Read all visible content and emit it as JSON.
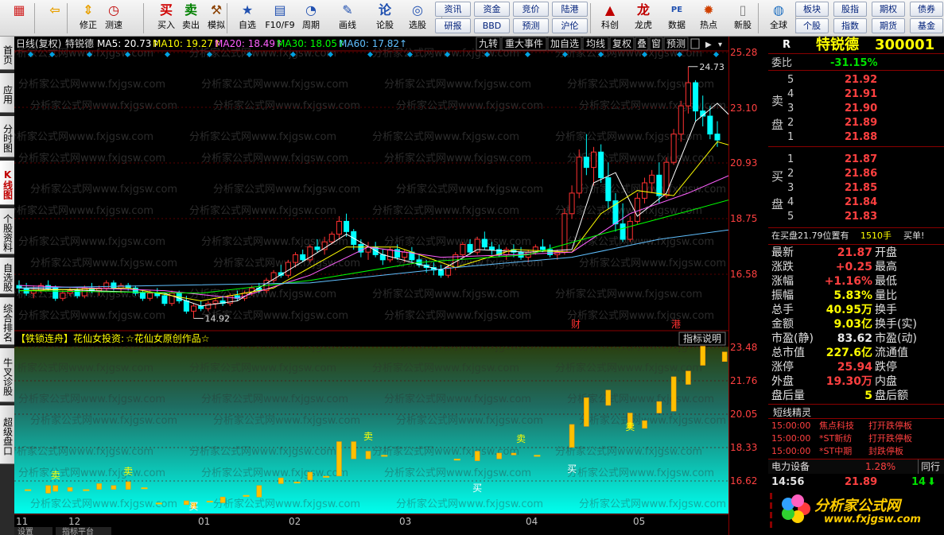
{
  "toolbar": {
    "items": [
      {
        "label": "",
        "icon": "windows-icon",
        "glyph": "▦",
        "color": "#d02020"
      },
      {
        "label": "",
        "icon": "back-icon",
        "glyph": "⇦",
        "color": "#e8a000"
      },
      {
        "label": "修正",
        "icon": "arrow-updown-icon",
        "glyph": "⇕",
        "color": "#e8a000"
      },
      {
        "label": "测速",
        "icon": "clock-icon",
        "glyph": "◷",
        "color": "#c00000"
      },
      {
        "label": "买入",
        "icon": "buy-icon",
        "glyph": "买",
        "color": "#d00000"
      },
      {
        "label": "卖出",
        "icon": "sell-icon",
        "glyph": "卖",
        "color": "#008000"
      },
      {
        "label": "模拟",
        "icon": "hammer-icon",
        "glyph": "⚒",
        "color": "#8a4000"
      },
      {
        "label": "自选",
        "icon": "star-icon",
        "glyph": "★",
        "color": "#2050b0"
      },
      {
        "label": "F10/F9",
        "icon": "f10-icon",
        "glyph": "▤",
        "color": "#2050b0"
      },
      {
        "label": "周期",
        "icon": "period-icon",
        "glyph": "◔",
        "color": "#2050b0"
      },
      {
        "label": "画线",
        "icon": "pen-icon",
        "glyph": "✎",
        "color": "#2050b0"
      },
      {
        "label": "论股",
        "icon": "chat-icon",
        "glyph": "论",
        "color": "#2050b0"
      },
      {
        "label": "选股",
        "icon": "select-icon",
        "glyph": "◎",
        "color": "#2050b0"
      },
      {
        "label": "科创",
        "icon": "chart-icon",
        "glyph": "▲",
        "color": "#c00000"
      },
      {
        "label": "龙虎",
        "icon": "dragon-icon",
        "glyph": "龙",
        "color": "#c00000"
      },
      {
        "label": "数据",
        "icon": "pe-icon",
        "glyph": "PE",
        "color": "#2050b0"
      },
      {
        "label": "热点",
        "icon": "fire-icon",
        "glyph": "✹",
        "color": "#d04000"
      },
      {
        "label": "新股",
        "icon": "doc-icon",
        "glyph": "▯",
        "color": "#808080"
      },
      {
        "label": "全球",
        "icon": "globe-icon",
        "glyph": "◍",
        "color": "#2070c0"
      }
    ],
    "buttons": [
      [
        "资讯",
        "资金",
        "竞价",
        "陆港"
      ],
      [
        "研报",
        "BBD",
        "预测",
        "沪伦"
      ]
    ],
    "right_buttons": [
      [
        "板块",
        "股指",
        "期权",
        "债券"
      ],
      [
        "个股",
        "指数",
        "期货",
        "基金"
      ]
    ]
  },
  "left_tabs": [
    {
      "label": "首页",
      "active": false
    },
    {
      "label": "应用",
      "active": false
    },
    {
      "label": "分时图",
      "active": false
    },
    {
      "label": "K线图",
      "active": true
    },
    {
      "label": "个股资料",
      "active": false
    },
    {
      "label": "自选股",
      "active": false
    },
    {
      "label": "综合排名",
      "active": false
    },
    {
      "label": "牛叉诊股",
      "active": false
    },
    {
      "label": "超级盘口",
      "active": false
    }
  ],
  "chart_header": {
    "period": "日线(复权)",
    "name": "特锐德",
    "ma": [
      {
        "label": "MA5: 20.73↑",
        "color": "#ffffff"
      },
      {
        "label": "MA10: 19.27↑",
        "color": "#ffff00"
      },
      {
        "label": "MA20: 18.49↑",
        "color": "#ff60ff"
      },
      {
        "label": "MA30: 18.05↑",
        "color": "#00ff00"
      },
      {
        "label": "MA60: 17.82↑",
        "color": "#60c0ff"
      }
    ],
    "menu": [
      "九转",
      "重大事件",
      "加自选",
      "均线",
      "复权",
      "叠",
      "窗",
      "预测"
    ]
  },
  "main_axis": [
    "25.28",
    "23.10",
    "20.93",
    "18.75",
    "16.58"
  ],
  "annotations": {
    "high": "24.73",
    "low": "14.92",
    "cai": "财",
    "gang": "港"
  },
  "indicator": {
    "title": "【铁锁连舟】花仙女投资:",
    "subtitle": "☆花仙女原创作品☆",
    "help": "指标说明",
    "axis": [
      "23.48",
      "21.76",
      "20.05",
      "18.33",
      "16.62"
    ],
    "buy": "买",
    "sell": "卖"
  },
  "x_labels": [
    "11",
    "12",
    "01",
    "02",
    "03",
    "04",
    "05"
  ],
  "bottom_tabs": [
    "设置",
    "指标平台"
  ],
  "watermarks": [
    "分析家公式网www.fxjgsw.com"
  ],
  "chart_data": {
    "type": "candlestick",
    "ylim": [
      14.5,
      25.28
    ],
    "candles": [
      [
        16.2,
        16.4,
        15.9,
        16.1
      ],
      [
        16.1,
        16.3,
        15.8,
        15.9
      ],
      [
        15.9,
        16.2,
        15.7,
        16.0
      ],
      [
        16.0,
        16.3,
        15.9,
        16.2
      ],
      [
        16.2,
        16.4,
        16.0,
        16.1
      ],
      [
        16.1,
        16.2,
        15.6,
        15.7
      ],
      [
        15.7,
        16.0,
        15.6,
        15.9
      ],
      [
        15.9,
        16.1,
        15.8,
        16.0
      ],
      [
        16.0,
        16.1,
        15.7,
        15.8
      ],
      [
        15.8,
        16.2,
        15.7,
        16.1
      ],
      [
        16.1,
        16.3,
        15.9,
        16.0
      ],
      [
        16.0,
        16.2,
        15.8,
        16.1
      ],
      [
        16.1,
        16.4,
        16.0,
        16.3
      ],
      [
        16.3,
        16.4,
        16.0,
        16.1
      ],
      [
        16.1,
        16.3,
        15.9,
        16.2
      ],
      [
        16.2,
        16.3,
        16.0,
        16.1
      ],
      [
        16.1,
        16.2,
        15.8,
        15.9
      ],
      [
        15.9,
        16.0,
        15.6,
        15.7
      ],
      [
        15.7,
        16.0,
        15.6,
        15.9
      ],
      [
        15.9,
        16.1,
        15.7,
        15.8
      ],
      [
        15.8,
        15.9,
        15.4,
        15.5
      ],
      [
        15.5,
        16.0,
        15.4,
        15.9
      ],
      [
        15.9,
        16.0,
        15.5,
        15.6
      ],
      [
        15.6,
        15.8,
        15.1,
        15.2
      ],
      [
        15.2,
        15.5,
        14.92,
        15.4
      ],
      [
        15.4,
        15.6,
        15.2,
        15.3
      ],
      [
        15.3,
        15.6,
        15.2,
        15.5
      ],
      [
        15.5,
        15.7,
        15.3,
        15.6
      ],
      [
        15.6,
        15.8,
        15.4,
        15.5
      ],
      [
        15.5,
        15.9,
        15.4,
        15.8
      ],
      [
        15.8,
        16.0,
        15.6,
        15.7
      ],
      [
        15.7,
        16.0,
        15.6,
        15.9
      ],
      [
        15.9,
        16.2,
        15.8,
        16.1
      ],
      [
        16.1,
        16.3,
        15.9,
        16.0
      ],
      [
        16.0,
        16.5,
        15.9,
        16.4
      ],
      [
        16.4,
        16.8,
        16.3,
        16.7
      ],
      [
        16.7,
        17.0,
        16.5,
        16.6
      ],
      [
        16.6,
        17.2,
        16.5,
        17.1
      ],
      [
        17.1,
        17.5,
        16.9,
        17.4
      ],
      [
        17.4,
        17.6,
        17.1,
        17.2
      ],
      [
        17.2,
        17.8,
        17.1,
        17.7
      ],
      [
        17.7,
        18.0,
        17.5,
        17.6
      ],
      [
        17.6,
        18.1,
        17.4,
        17.9
      ],
      [
        17.9,
        18.3,
        17.8,
        18.2
      ],
      [
        18.2,
        18.9,
        18.0,
        18.7
      ],
      [
        18.7,
        19.0,
        18.1,
        18.3
      ],
      [
        18.3,
        18.4,
        17.6,
        17.8
      ],
      [
        17.8,
        18.0,
        17.3,
        17.5
      ],
      [
        17.5,
        17.9,
        17.2,
        17.7
      ],
      [
        17.7,
        17.9,
        17.3,
        17.4
      ],
      [
        17.4,
        17.6,
        17.0,
        17.2
      ],
      [
        17.2,
        17.7,
        17.1,
        17.6
      ],
      [
        17.6,
        17.8,
        17.2,
        17.3
      ],
      [
        17.3,
        17.6,
        17.1,
        17.5
      ],
      [
        17.5,
        17.7,
        17.1,
        17.2
      ],
      [
        17.2,
        17.4,
        16.9,
        17.0
      ],
      [
        17.0,
        17.2,
        16.7,
        16.9
      ],
      [
        16.9,
        17.1,
        16.6,
        16.8
      ],
      [
        16.8,
        17.0,
        16.5,
        16.6
      ],
      [
        16.6,
        17.0,
        16.5,
        16.9
      ],
      [
        16.9,
        17.5,
        16.8,
        17.4
      ],
      [
        17.4,
        17.9,
        17.3,
        17.8
      ],
      [
        17.8,
        18.0,
        17.4,
        17.5
      ],
      [
        17.5,
        18.1,
        17.4,
        18.0
      ],
      [
        18.0,
        18.3,
        17.6,
        17.7
      ],
      [
        17.7,
        17.9,
        17.4,
        17.6
      ],
      [
        17.6,
        17.8,
        17.3,
        17.4
      ],
      [
        17.4,
        17.7,
        17.2,
        17.6
      ],
      [
        17.6,
        17.8,
        17.3,
        17.5
      ],
      [
        17.5,
        17.7,
        17.2,
        17.3
      ],
      [
        17.3,
        17.6,
        17.1,
        17.5
      ],
      [
        17.5,
        17.8,
        17.4,
        17.7
      ],
      [
        17.7,
        18.0,
        17.5,
        17.6
      ],
      [
        17.6,
        17.8,
        17.3,
        17.4
      ],
      [
        17.4,
        17.6,
        17.2,
        17.5
      ],
      [
        17.5,
        19.2,
        17.4,
        19.0
      ],
      [
        19.0,
        20.1,
        18.8,
        19.8
      ],
      [
        19.8,
        21.5,
        19.6,
        21.2
      ],
      [
        21.2,
        22.1,
        20.5,
        20.8
      ],
      [
        20.8,
        21.6,
        20.1,
        21.4
      ],
      [
        21.4,
        21.7,
        20.2,
        20.4
      ],
      [
        20.4,
        21.0,
        19.2,
        19.5
      ],
      [
        19.5,
        19.8,
        18.3,
        18.6
      ],
      [
        18.6,
        19.4,
        17.9,
        18.0
      ],
      [
        18.0,
        18.9,
        17.9,
        18.7
      ],
      [
        18.7,
        19.8,
        18.6,
        19.6
      ],
      [
        19.6,
        20.4,
        19.4,
        20.2
      ],
      [
        20.2,
        20.7,
        19.8,
        20.5
      ],
      [
        20.5,
        21.0,
        19.4,
        19.7
      ],
      [
        19.7,
        21.2,
        19.6,
        21.0
      ],
      [
        21.0,
        22.3,
        20.9,
        22.1
      ],
      [
        22.1,
        23.4,
        21.8,
        23.2
      ],
      [
        23.2,
        24.73,
        22.9,
        24.1
      ],
      [
        24.1,
        24.2,
        22.6,
        23.0
      ],
      [
        23.0,
        23.6,
        22.4,
        22.8
      ],
      [
        22.8,
        23.2,
        21.9,
        22.1
      ],
      [
        22.1,
        22.6,
        21.6,
        21.87
      ]
    ],
    "ma_lines": [
      {
        "name": "MA5",
        "color": "#ffffff",
        "points": [
          [
            0,
            16.1
          ],
          [
            10,
            16.0
          ],
          [
            20,
            15.9
          ],
          [
            25,
            15.4
          ],
          [
            30,
            15.6
          ],
          [
            40,
            17.3
          ],
          [
            45,
            18.2
          ],
          [
            50,
            17.4
          ],
          [
            58,
            16.8
          ],
          [
            63,
            17.6
          ],
          [
            70,
            17.5
          ],
          [
            76,
            17.6
          ],
          [
            79,
            20.2
          ],
          [
            82,
            20.6
          ],
          [
            85,
            18.9
          ],
          [
            89,
            19.8
          ],
          [
            93,
            22.6
          ],
          [
            96,
            23.3
          ],
          [
            101,
            21.9
          ]
        ]
      },
      {
        "name": "MA10",
        "color": "#ffff00",
        "points": [
          [
            0,
            16.0
          ],
          [
            15,
            16.1
          ],
          [
            25,
            15.6
          ],
          [
            35,
            16.1
          ],
          [
            45,
            17.7
          ],
          [
            52,
            17.7
          ],
          [
            60,
            16.9
          ],
          [
            68,
            17.6
          ],
          [
            76,
            17.5
          ],
          [
            80,
            19.0
          ],
          [
            85,
            19.9
          ],
          [
            90,
            19.7
          ],
          [
            96,
            21.8
          ],
          [
            101,
            21.4
          ]
        ]
      },
      {
        "name": "MA20",
        "color": "#ff60ff",
        "points": [
          [
            0,
            16.2
          ],
          [
            20,
            16.0
          ],
          [
            30,
            15.7
          ],
          [
            40,
            16.6
          ],
          [
            48,
            17.7
          ],
          [
            58,
            17.3
          ],
          [
            68,
            17.4
          ],
          [
            76,
            17.5
          ],
          [
            84,
            19.0
          ],
          [
            92,
            19.8
          ],
          [
            101,
            20.9
          ]
        ]
      },
      {
        "name": "MA30",
        "color": "#00ff00",
        "points": [
          [
            0,
            16.0
          ],
          [
            25,
            15.9
          ],
          [
            40,
            16.4
          ],
          [
            55,
            17.1
          ],
          [
            70,
            17.4
          ],
          [
            80,
            18.2
          ],
          [
            92,
            19.1
          ],
          [
            101,
            19.8
          ]
        ]
      },
      {
        "name": "MA60",
        "color": "#60c0ff",
        "points": [
          [
            0,
            16.1
          ],
          [
            40,
            16.3
          ],
          [
            60,
            16.9
          ],
          [
            76,
            17.3
          ],
          [
            88,
            18.0
          ],
          [
            101,
            18.5
          ]
        ]
      }
    ],
    "indicator_bars": [
      [
        4,
        15.8,
        16.2,
        "gold"
      ],
      [
        5,
        15.9,
        16.2,
        "gold"
      ],
      [
        7,
        15.9,
        16.1,
        "gold"
      ],
      [
        11,
        16.0,
        16.3,
        "gold"
      ],
      [
        13,
        16.0,
        16.2,
        "gold"
      ],
      [
        15,
        16.0,
        16.4,
        "gold"
      ],
      [
        23,
        15.2,
        15.4,
        "gold"
      ],
      [
        24,
        15.0,
        15.3,
        "gold"
      ],
      [
        28,
        15.3,
        15.6,
        "gold"
      ],
      [
        33,
        15.6,
        16.2,
        "gold"
      ],
      [
        36,
        16.3,
        16.6,
        "gold"
      ],
      [
        40,
        16.5,
        16.9,
        "gold"
      ],
      [
        44,
        16.7,
        18.5,
        "gold"
      ],
      [
        46,
        17.6,
        18.5,
        "gold"
      ],
      [
        48,
        17.6,
        18.0,
        "gold"
      ],
      [
        63,
        17.5,
        18.0,
        "gold"
      ],
      [
        66,
        17.6,
        17.9,
        "gold"
      ],
      [
        68,
        17.8,
        17.9,
        "gold"
      ],
      [
        76,
        18.2,
        19.4,
        "gold"
      ],
      [
        78,
        19.3,
        20.8,
        "gold"
      ],
      [
        81,
        20.4,
        21.2,
        "gold"
      ],
      [
        84,
        19.2,
        20.0,
        "gold"
      ],
      [
        86,
        19.2,
        19.6,
        "gold"
      ],
      [
        88,
        20.0,
        20.6,
        "gold"
      ],
      [
        90,
        20.1,
        21.9,
        "gold"
      ],
      [
        92,
        21.5,
        22.2,
        "gold"
      ],
      [
        94,
        22.5,
        23.5,
        "gold"
      ],
      [
        97,
        22.7,
        23.2,
        "gold"
      ],
      [
        99,
        22.1,
        22.7,
        "gold"
      ]
    ],
    "indicator_ylim": [
      14.9,
      23.48
    ],
    "buy_points": [
      24,
      63,
      76
    ],
    "sell_points": [
      5,
      15,
      48,
      69,
      84,
      101
    ]
  },
  "quote": {
    "flag": "R",
    "name": "特锐德",
    "code": "300001",
    "weibi_label": "委比",
    "weibi": "-31.15%",
    "sell_label": [
      "卖",
      "盘"
    ],
    "buy_label": [
      "买",
      "盘"
    ],
    "asks": [
      [
        "5",
        "21.92"
      ],
      [
        "4",
        "21.91"
      ],
      [
        "3",
        "21.90"
      ],
      [
        "2",
        "21.89"
      ],
      [
        "1",
        "21.88"
      ]
    ],
    "bids": [
      [
        "1",
        "21.87"
      ],
      [
        "2",
        "21.86"
      ],
      [
        "3",
        "21.85"
      ],
      [
        "4",
        "21.84"
      ],
      [
        "5",
        "21.83"
      ]
    ],
    "notice": "在买盘21.79位置有",
    "notice_qty": "1510手",
    "notice_tail": "买单!",
    "stats": [
      [
        "最新",
        "21.87",
        "red",
        "开盘",
        ""
      ],
      [
        "涨跌",
        "+0.25",
        "red",
        "最高",
        ""
      ],
      [
        "涨幅",
        "+1.16%",
        "red",
        "最低",
        ""
      ],
      [
        "振幅",
        "5.83%",
        "yel",
        "量比",
        ""
      ],
      [
        "总手",
        "40.95万",
        "yel",
        "换手",
        ""
      ],
      [
        "金额",
        "9.03亿",
        "yel",
        "换手(实)",
        ""
      ],
      [
        "市盈(静)",
        "83.62",
        "wh",
        "市盈(动)",
        ""
      ],
      [
        "总市值",
        "227.6亿",
        "yel",
        "流通值",
        ""
      ],
      [
        "涨停",
        "25.94",
        "red",
        "跌停",
        ""
      ],
      [
        "外盘",
        "19.30万",
        "red",
        "内盘",
        ""
      ],
      [
        "盘后量",
        "5",
        "yel",
        "盘后额",
        ""
      ]
    ],
    "elf_title": "短线精灵",
    "elf": [
      [
        "15:00:00",
        "焦点科技",
        "打开跌停板"
      ],
      [
        "15:00:00",
        "*ST新纺",
        "打开跌停板"
      ],
      [
        "15:00:00",
        "*ST中期",
        "封跌停板"
      ]
    ],
    "sector": "电力设备",
    "sector_pct": "1.28%",
    "sector_tab": "同行",
    "tick_time": "14:56",
    "tick_price": "21.89",
    "tick_vol": "14"
  },
  "logo": {
    "cn": "分析家公式网",
    "url": "www.fxjgsw.com"
  }
}
